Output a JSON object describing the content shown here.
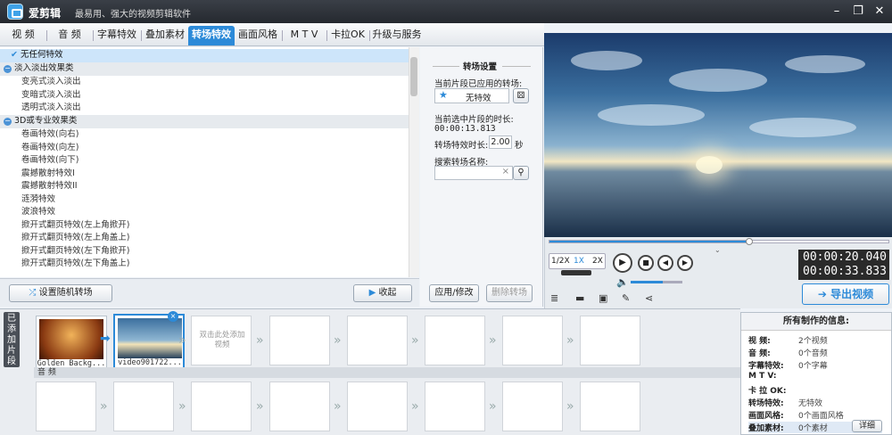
{
  "title": {
    "app": "爱剪辑",
    "slogan": "最易用、强大的视频剪辑软件"
  },
  "tabs": [
    "视 频",
    "音 频",
    "字幕特效",
    "叠加素材",
    "转场特效",
    "画面风格",
    "M T V",
    "卡拉OK",
    "升级与服务"
  ],
  "active_tab": "转场特效",
  "effects": [
    {
      "label": "无任何特效",
      "kind": "selected"
    },
    {
      "label": "淡入淡出效果类",
      "kind": "group"
    },
    {
      "label": "变亮式淡入淡出",
      "kind": "item"
    },
    {
      "label": "变暗式淡入淡出",
      "kind": "item"
    },
    {
      "label": "透明式淡入淡出",
      "kind": "item"
    },
    {
      "label": "3D或专业效果类",
      "kind": "group"
    },
    {
      "label": "卷画特效(向右)",
      "kind": "item"
    },
    {
      "label": "卷画特效(向左)",
      "kind": "item"
    },
    {
      "label": "卷画特效(向下)",
      "kind": "item"
    },
    {
      "label": "震撼散射特效I",
      "kind": "item"
    },
    {
      "label": "震撼散射特效II",
      "kind": "item"
    },
    {
      "label": "涟漪特效",
      "kind": "item"
    },
    {
      "label": "波浪特效",
      "kind": "item"
    },
    {
      "label": "掀开式翻页特效(左上角掀开)",
      "kind": "item"
    },
    {
      "label": "掀开式翻页特效(左上角盖上)",
      "kind": "item"
    },
    {
      "label": "掀开式翻页特效(左下角掀开)",
      "kind": "item"
    },
    {
      "label": "掀开式翻页特效(左下角盖上)",
      "kind": "item"
    }
  ],
  "list_footer": {
    "random": "设置随机转场",
    "collapse": "收起"
  },
  "settings": {
    "title": "转场设置",
    "applied_label": "当前片段已应用的转场:",
    "applied_value": "无特效",
    "duration_label": "当前选中片段的时长:",
    "duration_value": "00:00:13.813",
    "effect_duration_label": "转场特效时长:",
    "effect_duration_value": "2.00",
    "effect_duration_unit": "秒",
    "search_label": "搜索转场名称:",
    "search_value": "",
    "apply_button": "应用/修改",
    "delete_button": "删除转场"
  },
  "player": {
    "speeds": [
      "1/2X",
      "1X",
      "2X"
    ],
    "active_speed": "1X",
    "current_time": "00:00:20.040",
    "total_time": "00:00:33.833",
    "progress": 0.59,
    "volume": 0.62,
    "export_button": "导出视频"
  },
  "strip": {
    "label": "已添加片段",
    "clips": [
      {
        "name": "Golden Backg..."
      },
      {
        "name": "video901722..."
      }
    ],
    "add_hint": "双击此处添加视频",
    "audio_label": "音 频"
  },
  "info": {
    "title": "所有制作的信息:",
    "rows": [
      {
        "k": "视 频:",
        "v": "2个视频"
      },
      {
        "k": "音 频:",
        "v": "0个音频"
      },
      {
        "k": "字幕特效:",
        "v": "0个字幕"
      },
      {
        "k": "M T V:",
        "v": ""
      },
      {
        "k": "卡 拉 OK:",
        "v": ""
      },
      {
        "k": "转场特效:",
        "v": "无特效"
      },
      {
        "k": "画面风格:",
        "v": "0个画面风格"
      },
      {
        "k": "叠加素材:",
        "v": "0个素材"
      }
    ],
    "detail_button": "详细"
  },
  "colors": {
    "accent": "#2c8ad8",
    "titlebar": "#2d3138"
  }
}
